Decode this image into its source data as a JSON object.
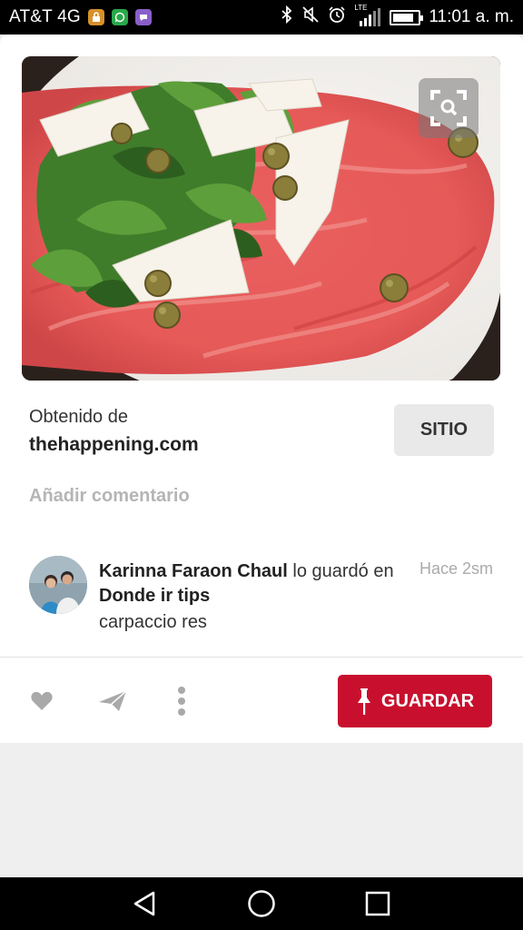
{
  "status_bar": {
    "carrier": "AT&T 4G",
    "network_badge": "LTE",
    "time": "11:01 a. m.",
    "battery_level": 0.85,
    "notification_icons": [
      "lock-notification-icon",
      "whatsapp-icon",
      "app-notification-icon"
    ],
    "system_icons": [
      "bluetooth-icon",
      "mute-icon",
      "alarm-icon",
      "signal-icon",
      "battery-icon"
    ]
  },
  "pin": {
    "image_subject": "carpaccio",
    "source_label": "Obtenido de",
    "source_domain": "thehappening.com",
    "site_button": "SITIO",
    "add_comment": "Añadir comentario"
  },
  "activity": {
    "user_name": "Karinna Faraon Chaul",
    "action_text": " lo guardó en ",
    "board_name": "Donde ir tips",
    "time_ago": "Hace 2sm",
    "description": "carpaccio res"
  },
  "actions": {
    "save_label": "GUARDAR",
    "icons": [
      "heart-icon",
      "send-icon",
      "more-options-icon"
    ]
  },
  "colors": {
    "save_button": "#c8102e",
    "status_bar": "#000000",
    "background": "#efefef"
  }
}
